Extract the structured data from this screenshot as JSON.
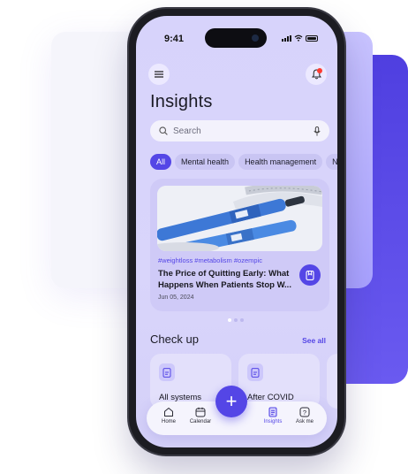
{
  "status": {
    "time": "9:41"
  },
  "page": {
    "title": "Insights"
  },
  "search": {
    "placeholder": "Search"
  },
  "chips": [
    "All",
    "Mental health",
    "Health management",
    "N"
  ],
  "article": {
    "tags": "#weightloss  #metabolism  #ozempic",
    "title": "The Price of Quitting Early: What Happens When Patients Stop W...",
    "date": "Jun 05, 2024"
  },
  "carousel": {
    "count": 3,
    "active_index": 0
  },
  "checkup": {
    "title": "Check up",
    "see_all": "See all",
    "cards": [
      "All systems",
      "After COVID"
    ]
  },
  "tabbar": {
    "items": [
      "Home",
      "Calendar",
      "Insights",
      "Ask me"
    ],
    "active": "Insights",
    "fab_label": "+"
  },
  "colors": {
    "accent": "#5446e6",
    "background": "#d7d3fb",
    "notification": "#ff3b30"
  }
}
